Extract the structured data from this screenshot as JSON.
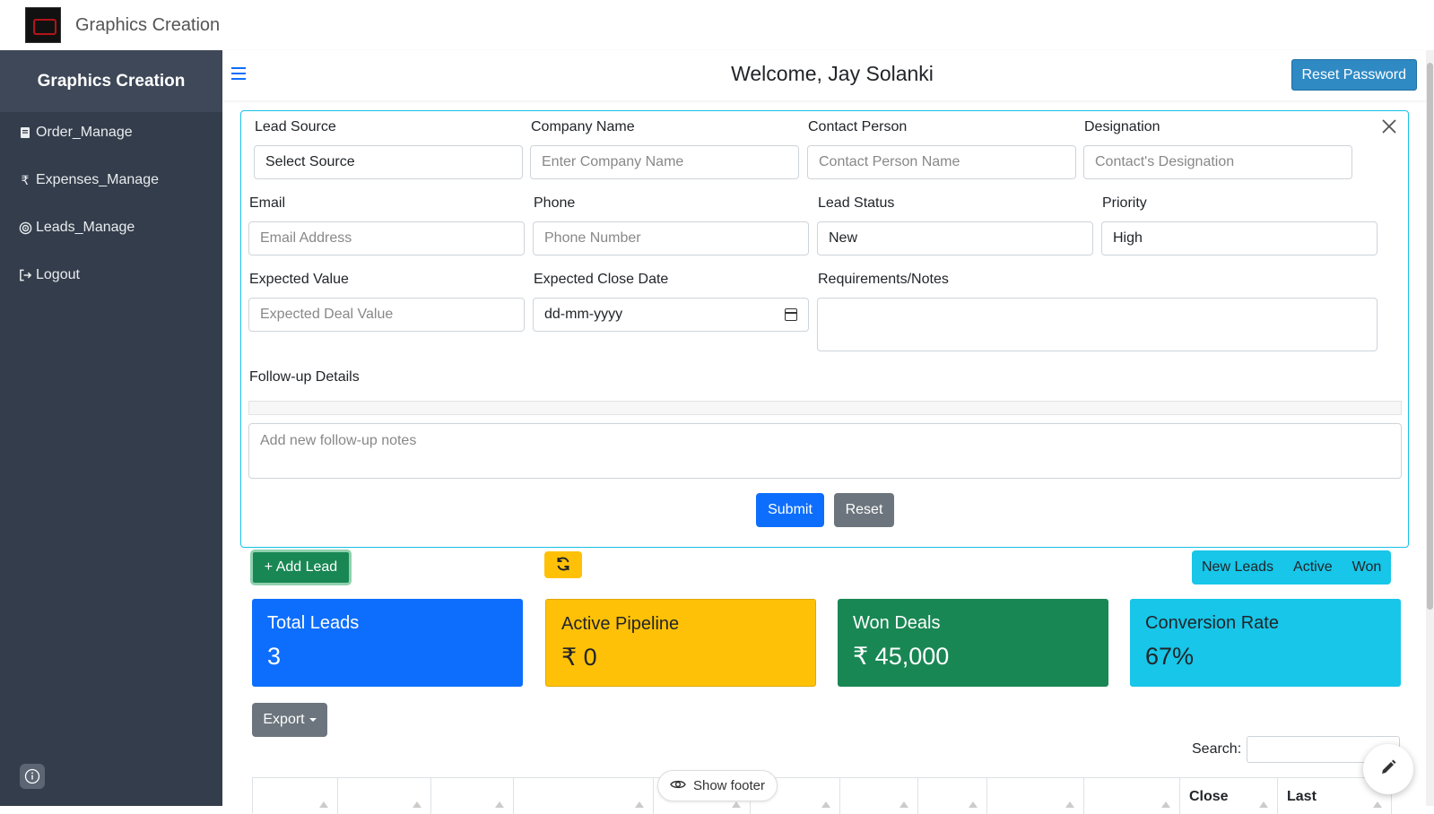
{
  "topbar": {
    "app_title": "Graphics Creation"
  },
  "sidebar": {
    "brand": "Graphics Creation",
    "items": [
      {
        "label": "Order_Manage",
        "icon": "book-icon"
      },
      {
        "label": "Expenses_Manage",
        "icon": "rupee-icon"
      },
      {
        "label": "Leads_Manage",
        "icon": "target-icon"
      },
      {
        "label": "Logout",
        "icon": "logout-icon"
      }
    ]
  },
  "header": {
    "welcome": "Welcome, Jay Solanki",
    "reset_password": "Reset Password"
  },
  "form": {
    "lead_source": {
      "label": "Lead Source",
      "value": "Select Source"
    },
    "company_name": {
      "label": "Company Name",
      "placeholder": "Enter Company Name"
    },
    "contact_person": {
      "label": "Contact Person",
      "placeholder": "Contact Person Name"
    },
    "designation": {
      "label": "Designation",
      "placeholder": "Contact's Designation"
    },
    "email": {
      "label": "Email",
      "placeholder": "Email Address"
    },
    "phone": {
      "label": "Phone",
      "placeholder": "Phone Number"
    },
    "lead_status": {
      "label": "Lead Status",
      "value": "New"
    },
    "priority": {
      "label": "Priority",
      "value": "High"
    },
    "expected_value": {
      "label": "Expected Value",
      "placeholder": "Expected Deal Value"
    },
    "expected_close_date": {
      "label": "Expected Close Date",
      "value": "dd-mm-yyyy"
    },
    "requirements": {
      "label": "Requirements/Notes",
      "value": ""
    },
    "followup": {
      "label": "Follow-up Details",
      "placeholder": "Add new follow-up notes"
    },
    "submit": "Submit",
    "reset": "Reset"
  },
  "actions": {
    "add_lead": "+ Add Lead",
    "filters": [
      "New Leads",
      "Active",
      "Won"
    ]
  },
  "stats": [
    {
      "title": "Total Leads",
      "value": "3",
      "color": "#0d6efd",
      "text_color": "#ffffff"
    },
    {
      "title": "Active Pipeline",
      "value": "₹ 0",
      "color": "#ffc107",
      "text_color": "#212529"
    },
    {
      "title": "Won Deals",
      "value": "₹ 45,000",
      "color": "#198754",
      "text_color": "#ffffff"
    },
    {
      "title": "Conversion Rate",
      "value": "67%",
      "color": "#17c6e8",
      "text_color": "#212529"
    }
  ],
  "table": {
    "export": "Export",
    "search_label": "Search:",
    "columns": [
      "",
      "",
      "",
      "",
      "",
      "",
      "",
      "",
      "",
      "",
      "Close",
      "Last",
      ""
    ]
  },
  "show_footer": "Show footer"
}
